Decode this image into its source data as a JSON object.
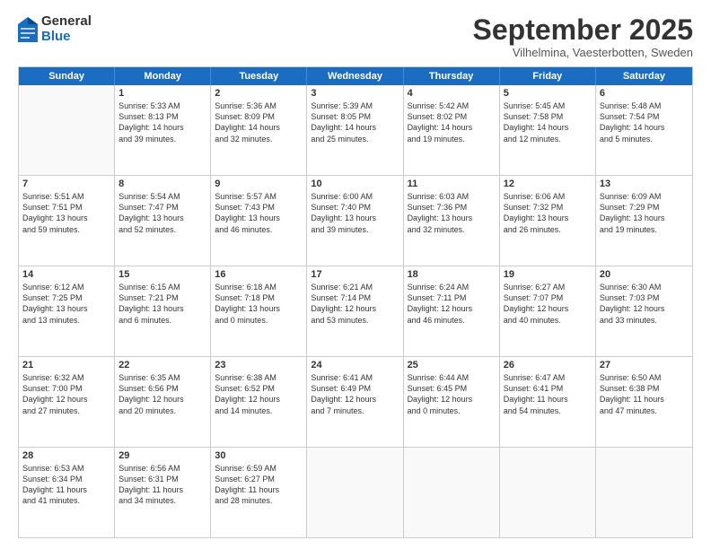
{
  "header": {
    "logo_general": "General",
    "logo_blue": "Blue",
    "month_title": "September 2025",
    "location": "Vilhelmina, Vaesterbotten, Sweden"
  },
  "weekdays": [
    "Sunday",
    "Monday",
    "Tuesday",
    "Wednesday",
    "Thursday",
    "Friday",
    "Saturday"
  ],
  "rows": [
    [
      {
        "day": "",
        "lines": []
      },
      {
        "day": "1",
        "lines": [
          "Sunrise: 5:33 AM",
          "Sunset: 8:13 PM",
          "Daylight: 14 hours",
          "and 39 minutes."
        ]
      },
      {
        "day": "2",
        "lines": [
          "Sunrise: 5:36 AM",
          "Sunset: 8:09 PM",
          "Daylight: 14 hours",
          "and 32 minutes."
        ]
      },
      {
        "day": "3",
        "lines": [
          "Sunrise: 5:39 AM",
          "Sunset: 8:05 PM",
          "Daylight: 14 hours",
          "and 25 minutes."
        ]
      },
      {
        "day": "4",
        "lines": [
          "Sunrise: 5:42 AM",
          "Sunset: 8:02 PM",
          "Daylight: 14 hours",
          "and 19 minutes."
        ]
      },
      {
        "day": "5",
        "lines": [
          "Sunrise: 5:45 AM",
          "Sunset: 7:58 PM",
          "Daylight: 14 hours",
          "and 12 minutes."
        ]
      },
      {
        "day": "6",
        "lines": [
          "Sunrise: 5:48 AM",
          "Sunset: 7:54 PM",
          "Daylight: 14 hours",
          "and 5 minutes."
        ]
      }
    ],
    [
      {
        "day": "7",
        "lines": [
          "Sunrise: 5:51 AM",
          "Sunset: 7:51 PM",
          "Daylight: 13 hours",
          "and 59 minutes."
        ]
      },
      {
        "day": "8",
        "lines": [
          "Sunrise: 5:54 AM",
          "Sunset: 7:47 PM",
          "Daylight: 13 hours",
          "and 52 minutes."
        ]
      },
      {
        "day": "9",
        "lines": [
          "Sunrise: 5:57 AM",
          "Sunset: 7:43 PM",
          "Daylight: 13 hours",
          "and 46 minutes."
        ]
      },
      {
        "day": "10",
        "lines": [
          "Sunrise: 6:00 AM",
          "Sunset: 7:40 PM",
          "Daylight: 13 hours",
          "and 39 minutes."
        ]
      },
      {
        "day": "11",
        "lines": [
          "Sunrise: 6:03 AM",
          "Sunset: 7:36 PM",
          "Daylight: 13 hours",
          "and 32 minutes."
        ]
      },
      {
        "day": "12",
        "lines": [
          "Sunrise: 6:06 AM",
          "Sunset: 7:32 PM",
          "Daylight: 13 hours",
          "and 26 minutes."
        ]
      },
      {
        "day": "13",
        "lines": [
          "Sunrise: 6:09 AM",
          "Sunset: 7:29 PM",
          "Daylight: 13 hours",
          "and 19 minutes."
        ]
      }
    ],
    [
      {
        "day": "14",
        "lines": [
          "Sunrise: 6:12 AM",
          "Sunset: 7:25 PM",
          "Daylight: 13 hours",
          "and 13 minutes."
        ]
      },
      {
        "day": "15",
        "lines": [
          "Sunrise: 6:15 AM",
          "Sunset: 7:21 PM",
          "Daylight: 13 hours",
          "and 6 minutes."
        ]
      },
      {
        "day": "16",
        "lines": [
          "Sunrise: 6:18 AM",
          "Sunset: 7:18 PM",
          "Daylight: 13 hours",
          "and 0 minutes."
        ]
      },
      {
        "day": "17",
        "lines": [
          "Sunrise: 6:21 AM",
          "Sunset: 7:14 PM",
          "Daylight: 12 hours",
          "and 53 minutes."
        ]
      },
      {
        "day": "18",
        "lines": [
          "Sunrise: 6:24 AM",
          "Sunset: 7:11 PM",
          "Daylight: 12 hours",
          "and 46 minutes."
        ]
      },
      {
        "day": "19",
        "lines": [
          "Sunrise: 6:27 AM",
          "Sunset: 7:07 PM",
          "Daylight: 12 hours",
          "and 40 minutes."
        ]
      },
      {
        "day": "20",
        "lines": [
          "Sunrise: 6:30 AM",
          "Sunset: 7:03 PM",
          "Daylight: 12 hours",
          "and 33 minutes."
        ]
      }
    ],
    [
      {
        "day": "21",
        "lines": [
          "Sunrise: 6:32 AM",
          "Sunset: 7:00 PM",
          "Daylight: 12 hours",
          "and 27 minutes."
        ]
      },
      {
        "day": "22",
        "lines": [
          "Sunrise: 6:35 AM",
          "Sunset: 6:56 PM",
          "Daylight: 12 hours",
          "and 20 minutes."
        ]
      },
      {
        "day": "23",
        "lines": [
          "Sunrise: 6:38 AM",
          "Sunset: 6:52 PM",
          "Daylight: 12 hours",
          "and 14 minutes."
        ]
      },
      {
        "day": "24",
        "lines": [
          "Sunrise: 6:41 AM",
          "Sunset: 6:49 PM",
          "Daylight: 12 hours",
          "and 7 minutes."
        ]
      },
      {
        "day": "25",
        "lines": [
          "Sunrise: 6:44 AM",
          "Sunset: 6:45 PM",
          "Daylight: 12 hours",
          "and 0 minutes."
        ]
      },
      {
        "day": "26",
        "lines": [
          "Sunrise: 6:47 AM",
          "Sunset: 6:41 PM",
          "Daylight: 11 hours",
          "and 54 minutes."
        ]
      },
      {
        "day": "27",
        "lines": [
          "Sunrise: 6:50 AM",
          "Sunset: 6:38 PM",
          "Daylight: 11 hours",
          "and 47 minutes."
        ]
      }
    ],
    [
      {
        "day": "28",
        "lines": [
          "Sunrise: 6:53 AM",
          "Sunset: 6:34 PM",
          "Daylight: 11 hours",
          "and 41 minutes."
        ]
      },
      {
        "day": "29",
        "lines": [
          "Sunrise: 6:56 AM",
          "Sunset: 6:31 PM",
          "Daylight: 11 hours",
          "and 34 minutes."
        ]
      },
      {
        "day": "30",
        "lines": [
          "Sunrise: 6:59 AM",
          "Sunset: 6:27 PM",
          "Daylight: 11 hours",
          "and 28 minutes."
        ]
      },
      {
        "day": "",
        "lines": []
      },
      {
        "day": "",
        "lines": []
      },
      {
        "day": "",
        "lines": []
      },
      {
        "day": "",
        "lines": []
      }
    ]
  ]
}
